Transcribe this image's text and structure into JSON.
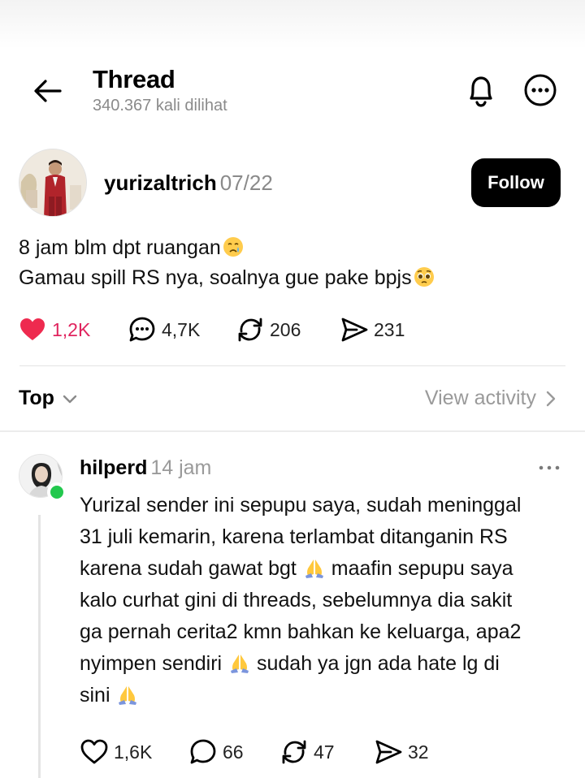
{
  "header": {
    "title": "Thread",
    "views": "340.367 kali dilihat"
  },
  "post": {
    "author": "yurizaltrich",
    "date": "07/22",
    "follow_label": "Follow",
    "lines": [
      "8 jam blm dpt ruangan",
      "Gamau spill RS nya, soalnya gue pake bpjs"
    ],
    "likes": "1,2K",
    "comments": "4,7K",
    "reposts": "206",
    "shares": "231"
  },
  "sort": {
    "label": "Top",
    "activity_label": "View activity"
  },
  "reply": {
    "author": "hilperd",
    "time": "14 jam",
    "lines": [
      "Yurizal sender ini sepupu saya, sudah meninggal",
      "31 juli kemarin, karena terlambat ditanganin RS",
      [
        "karena sudah gawat bgt ",
        " maafin sepupu saya"
      ],
      "kalo curhat gini di threads, sebelumnya dia sakit",
      "ga pernah cerita2 kmn bahkan ke keluarga, apa2",
      [
        "nyimpen sendiri ",
        " sudah ya jgn ada hate lg di"
      ],
      [
        "sini ",
        ""
      ]
    ],
    "likes": "1,6K",
    "comments": "66",
    "reposts": "47",
    "shares": "32"
  },
  "colors": {
    "like_red": "#e0245e",
    "online_green": "#22c84d",
    "muted_text": "#8a8a8a"
  },
  "icons": [
    "back-arrow-icon",
    "bell-icon",
    "more-icon",
    "heart-icon",
    "comment-icon",
    "repost-icon",
    "share-icon",
    "chevron-down-icon",
    "chevron-right-icon",
    "crying-face-emoji",
    "pleading-face-emoji",
    "folded-hands-emoji"
  ]
}
